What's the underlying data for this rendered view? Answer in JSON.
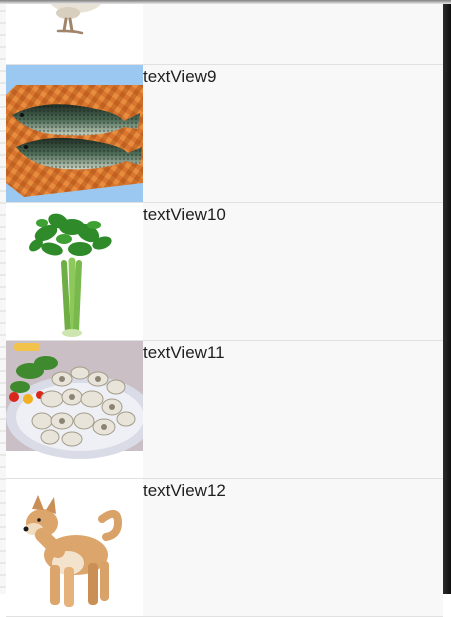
{
  "list": {
    "items": [
      {
        "label": "",
        "image": "chicken-image"
      },
      {
        "label": "textView9",
        "image": "fish-image"
      },
      {
        "label": "textView10",
        "image": "celery-image"
      },
      {
        "label": "textView11",
        "image": "mushroom-platter-image"
      },
      {
        "label": "textView12",
        "image": "dog-image"
      }
    ]
  }
}
